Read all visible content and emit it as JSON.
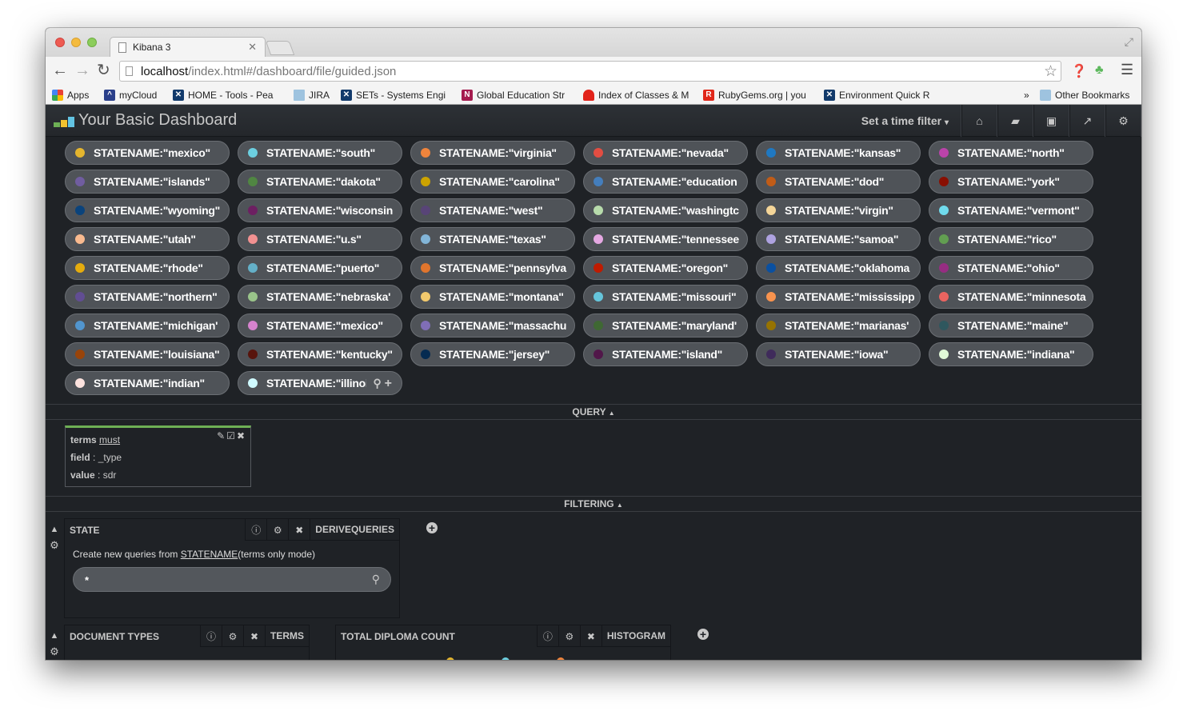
{
  "browser": {
    "tab_title": "Kibana 3",
    "url_host": "localhost",
    "url_path": "/index.html#/dashboard/file/guided.json",
    "bookmarks": [
      {
        "label": "Apps",
        "icon": "apps-grid-icon",
        "color": "#e94235"
      },
      {
        "label": "myCloud",
        "icon": "mycloud-icon",
        "color": "#2a3f8a"
      },
      {
        "label": "HOME - Tools - Pea",
        "fade": "r",
        "icon": "site-icon",
        "color": "#123a6b"
      },
      {
        "label": "JIRA",
        "icon": "folder-icon",
        "color": "#9ec3df"
      },
      {
        "label": "SETs - Systems Engi",
        "fade": "",
        "icon": "site-icon",
        "color": "#123a6b"
      },
      {
        "label": "Global Education Str",
        "fade": "",
        "icon": "n-icon",
        "color": "#a51c4f"
      },
      {
        "label": "Index of Classes & M",
        "fade": "",
        "icon": "ruby-doc-icon",
        "color": "#e2231a"
      },
      {
        "label": "RubyGems.org | you",
        "fade": "",
        "icon": "rubygems-icon",
        "color": "#e0271a"
      },
      {
        "label": "Environment Quick R",
        "fade": "",
        "icon": "site-icon",
        "color": "#123a6b"
      }
    ],
    "overflow": "»",
    "other_bookmarks": "Other Bookmarks"
  },
  "navbar": {
    "title": "Your Basic Dashboard",
    "time_filter": "Set a time filter",
    "buttons": [
      "home-icon",
      "folder-open-icon",
      "save-icon",
      "share-icon",
      "settings-icon"
    ]
  },
  "queries": [
    {
      "label": "STATENAME:\"mexico\"",
      "color": "#e4b52e"
    },
    {
      "label": "STATENAME:\"south\"",
      "color": "#6ccfe0"
    },
    {
      "label": "STATENAME:\"virginia\"",
      "color": "#ef843c"
    },
    {
      "label": "STATENAME:\"nevada\"",
      "color": "#e24d42"
    },
    {
      "label": "STATENAME:\"kansas\"",
      "color": "#1f78c1"
    },
    {
      "label": "STATENAME:\"north\"",
      "color": "#ba43a9"
    },
    {
      "label": "STATENAME:\"islands\"",
      "color": "#705da0"
    },
    {
      "label": "STATENAME:\"dakota\"",
      "color": "#508642"
    },
    {
      "label": "STATENAME:\"carolina\"",
      "color": "#cca300"
    },
    {
      "label": "STATENAME:\"education",
      "color": "#447ebc"
    },
    {
      "label": "STATENAME:\"dod\"",
      "color": "#c15c17"
    },
    {
      "label": "STATENAME:\"york\"",
      "color": "#890f02"
    },
    {
      "label": "STATENAME:\"wyoming\"",
      "color": "#0a437c"
    },
    {
      "label": "STATENAME:\"wisconsin",
      "color": "#6d1f62"
    },
    {
      "label": "STATENAME:\"west\"",
      "color": "#584477"
    },
    {
      "label": "STATENAME:\"washingtc",
      "color": "#b7dbab"
    },
    {
      "label": "STATENAME:\"virgin\"",
      "color": "#f4d598"
    },
    {
      "label": "STATENAME:\"vermont\"",
      "color": "#70dbed"
    },
    {
      "label": "STATENAME:\"utah\"",
      "color": "#f9ba8f"
    },
    {
      "label": "STATENAME:\"u.s\"",
      "color": "#f29191"
    },
    {
      "label": "STATENAME:\"texas\"",
      "color": "#82b5d8"
    },
    {
      "label": "STATENAME:\"tennessee",
      "color": "#e5a8e2"
    },
    {
      "label": "STATENAME:\"samoa\"",
      "color": "#aea2e0"
    },
    {
      "label": "STATENAME:\"rico\"",
      "color": "#629e51"
    },
    {
      "label": "STATENAME:\"rhode\"",
      "color": "#e5ac0e"
    },
    {
      "label": "STATENAME:\"puerto\"",
      "color": "#64b0c8"
    },
    {
      "label": "STATENAME:\"pennsylva",
      "color": "#e0752d"
    },
    {
      "label": "STATENAME:\"oregon\"",
      "color": "#bf1b00"
    },
    {
      "label": "STATENAME:\"oklahoma",
      "color": "#0a50a1"
    },
    {
      "label": "STATENAME:\"ohio\"",
      "color": "#962d82"
    },
    {
      "label": "STATENAME:\"northern\"",
      "color": "#614d93"
    },
    {
      "label": "STATENAME:\"nebraska'",
      "color": "#9ac48a"
    },
    {
      "label": "STATENAME:\"montana\"",
      "color": "#f2c96d"
    },
    {
      "label": "STATENAME:\"missouri\"",
      "color": "#65c5db"
    },
    {
      "label": "STATENAME:\"mississipp",
      "color": "#f9934e"
    },
    {
      "label": "STATENAME:\"minnesota",
      "color": "#ea6460"
    },
    {
      "label": "STATENAME:\"michigan'",
      "color": "#5195ce"
    },
    {
      "label": "STATENAME:\"mexico\"",
      "color": "#d683ce"
    },
    {
      "label": "STATENAME:\"massachu",
      "color": "#806eb7"
    },
    {
      "label": "STATENAME:\"maryland'",
      "color": "#3f6833"
    },
    {
      "label": "STATENAME:\"marianas'",
      "color": "#967302"
    },
    {
      "label": "STATENAME:\"maine\"",
      "color": "#2f575e"
    },
    {
      "label": "STATENAME:\"louisiana\"",
      "color": "#99440a"
    },
    {
      "label": "STATENAME:\"kentucky\"",
      "color": "#58140c"
    },
    {
      "label": "STATENAME:\"jersey\"",
      "color": "#052b51"
    },
    {
      "label": "STATENAME:\"island\"",
      "color": "#511749"
    },
    {
      "label": "STATENAME:\"iowa\"",
      "color": "#3f2b5b"
    },
    {
      "label": "STATENAME:\"indiana\"",
      "color": "#e0f9d7"
    },
    {
      "label": "STATENAME:\"indian\"",
      "color": "#fce2de"
    },
    {
      "label": "STATENAME:\"illinoi",
      "color": "#cffaff",
      "actions": true
    }
  ],
  "query_row_label": "QUERY",
  "filtering_row_label": "FILTERING",
  "filter": {
    "type_label": "terms",
    "mandate": "must",
    "field_key": "field",
    "field_value": "_type",
    "value_key": "value",
    "value_value": "sdr"
  },
  "state_panel": {
    "title": "STATE",
    "type": "DERIVEQUERIES",
    "desc_prefix": "Create new queries from ",
    "desc_field": "STATENAME",
    "desc_suffix": "(terms only mode)",
    "input_value": "*"
  },
  "doc_types_panel": {
    "title": "DOCUMENT TYPES",
    "type": "TERMS"
  },
  "diploma_panel": {
    "title": "TOTAL DIPLOMA COUNT",
    "type": "HISTOGRAM"
  }
}
